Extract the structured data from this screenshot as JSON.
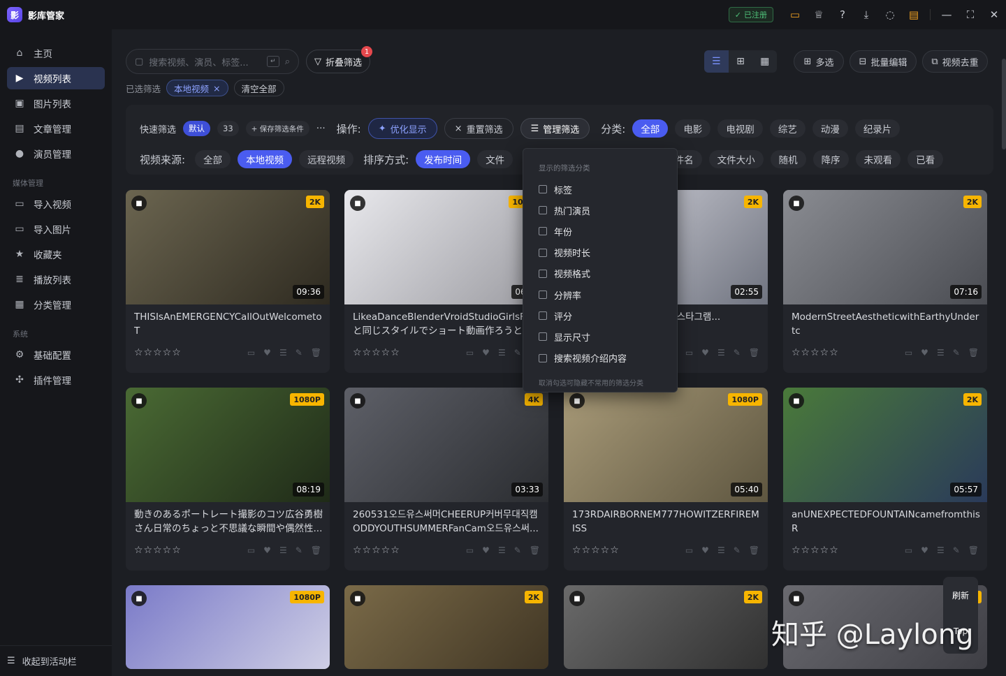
{
  "app": {
    "logo": "影",
    "name": "影库管家",
    "registered": "已注册"
  },
  "sidebar": {
    "items": [
      {
        "label": "主页",
        "icon": "home-icon"
      },
      {
        "label": "视频列表",
        "icon": "video-list-icon"
      },
      {
        "label": "图片列表",
        "icon": "image-icon"
      },
      {
        "label": "文章管理",
        "icon": "article-icon"
      },
      {
        "label": "演员管理",
        "icon": "user-icon"
      }
    ],
    "group_media": "媒体管理",
    "media_items": [
      {
        "label": "导入视频",
        "icon": "folder-icon"
      },
      {
        "label": "导入图片",
        "icon": "folder-icon"
      },
      {
        "label": "收藏夹",
        "icon": "star-icon"
      },
      {
        "label": "播放列表",
        "icon": "playlist-icon"
      },
      {
        "label": "分类管理",
        "icon": "grid-icon"
      }
    ],
    "group_system": "系统",
    "system_items": [
      {
        "label": "基础配置",
        "icon": "gear-icon"
      },
      {
        "label": "插件管理",
        "icon": "plugin-icon"
      }
    ],
    "collapse": "收起到活动栏"
  },
  "toolbar": {
    "search_placeholder": "搜索视频、演员、标签...",
    "fold_filter": "折叠筛选",
    "fold_badge": "1",
    "multi_select": "多选",
    "batch_edit": "批量编辑",
    "dedupe": "视频去重"
  },
  "chosen": {
    "label": "已选筛选",
    "chip": "本地视频",
    "clear": "清空全部"
  },
  "filters": {
    "quick_label": "快速筛选",
    "quick_default": "默认",
    "quick_num": "33",
    "save_cond": "+ 保存筛选条件",
    "more": "···",
    "ops_label": "操作:",
    "optimize": "优化显示",
    "reset": "重置筛选",
    "manage": "管理筛选",
    "cat_label": "分类:",
    "categories": [
      "全部",
      "电影",
      "电视剧",
      "综艺",
      "动漫",
      "纪录片"
    ],
    "source_label": "视频来源:",
    "sources": [
      "全部",
      "本地视频",
      "远程视频"
    ],
    "sort_label": "排序方式:",
    "sorts": [
      "发布时间",
      "文件",
      "文件名",
      "文件大小",
      "随机",
      "降序",
      "未观看",
      "已看"
    ]
  },
  "dropdown": {
    "head": "显示的筛选分类",
    "items": [
      "标签",
      "热门演员",
      "年份",
      "视频时长",
      "视频格式",
      "分辨率",
      "评分",
      "显示尺寸",
      "搜索视频介绍内容"
    ],
    "foot": "取消勾选可隐藏不常用的筛选分类"
  },
  "cards": [
    {
      "res": "2K",
      "dur": "09:36",
      "title": "THISIsAnEMERGENCYCallOutWelcometoT",
      "c1": "#6b6550",
      "c2": "#2e2a20"
    },
    {
      "res": "1080P",
      "dur": "06:12",
      "title": "LikeaDanceBlenderVroidStudioGirlsFigh と同じスタイルでショート動画作ろうと思",
      "c1": "#e8e8ec",
      "c2": "#9a9aa0"
    },
    {
      "res": "2K",
      "dur": "02:55",
      "title": "Cozy나연ABCD홍대버 인스타그램...",
      "c1": "#d8d8e0",
      "c2": "#707480"
    },
    {
      "res": "2K",
      "dur": "07:16",
      "title": "ModernStreetAestheticwithEarthyUndertc",
      "c1": "#8a8c92",
      "c2": "#4a4c52"
    },
    {
      "res": "1080P",
      "dur": "08:19",
      "title": "動きのあるポートレート撮影のコツ広谷勇樹さん日常のちょっと不思議な瞬間や偶然性...",
      "c1": "#4a6a34",
      "c2": "#1f2a18"
    },
    {
      "res": "4K",
      "dur": "03:33",
      "title": "260531오드유스써머CHEERUP커버무대직캠ODDYOUTHSUMMERFanCam오드유스써...",
      "c1": "#5e6068",
      "c2": "#2a2c30"
    },
    {
      "res": "1080P",
      "dur": "05:40",
      "title": "173RDAIRBORNEM777HOWITZERFIREMISS",
      "c1": "#a89a78",
      "c2": "#5e5640"
    },
    {
      "res": "2K",
      "dur": "05:57",
      "title": "anUNEXPECTEDFOUNTAINcamefromthisR",
      "c1": "#4a7a3a",
      "c2": "#2a3a5a"
    },
    {
      "res": "1080P",
      "dur": "",
      "title": "",
      "c1": "#7a7ac8",
      "c2": "#d8d8e8"
    },
    {
      "res": "2K",
      "dur": "",
      "title": "",
      "c1": "#7a6a48",
      "c2": "#3a3020"
    },
    {
      "res": "2K",
      "dur": "",
      "title": "",
      "c1": "#6a6a6a",
      "c2": "#2a2a2a"
    },
    {
      "res": "2K",
      "dur": "",
      "title": "",
      "c1": "#6a6a70",
      "c2": "#3a3a40"
    }
  ],
  "refresh": {
    "label": "刷新",
    "top": "Top"
  },
  "watermark": "知乎 @Laylong"
}
